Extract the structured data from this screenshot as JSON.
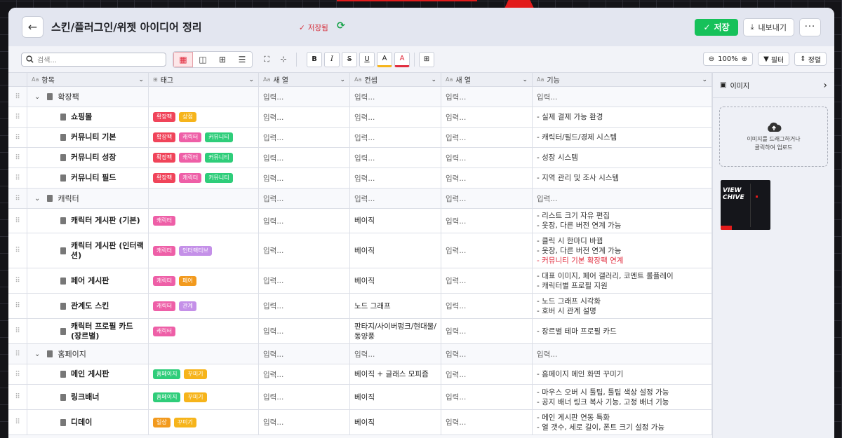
{
  "header": {
    "title": "스킨/플러그인/위젯 아이디어 정리",
    "saved": "저장됨",
    "save": "저장",
    "export": "내보내기",
    "more": "···"
  },
  "toolbar": {
    "search_placeholder": "검색...",
    "zoom": "100%",
    "filter": "필터",
    "sort": "정렬"
  },
  "columns": [
    {
      "label": "항목",
      "type": "Aa"
    },
    {
      "label": "태그",
      "type": "⊞"
    },
    {
      "label": "새 열",
      "type": "Aa"
    },
    {
      "label": "컨셉",
      "type": "Aa"
    },
    {
      "label": "새 열",
      "type": "Aa"
    },
    {
      "label": "기능",
      "type": "Aa"
    }
  ],
  "placeholder": "입력...",
  "rows": [
    {
      "kind": "group",
      "name": "확장팩",
      "tags": [],
      "concept": "",
      "func": []
    },
    {
      "kind": "item",
      "name": "쇼핑몰",
      "tags": [
        [
          "확장팩",
          "red"
        ],
        [
          "상점",
          "yel"
        ]
      ],
      "concept": "",
      "func": [
        "- 실제 결제 가능 환경"
      ]
    },
    {
      "kind": "item",
      "name": "커뮤니티 기본",
      "tags": [
        [
          "확장팩",
          "red"
        ],
        [
          "캐릭터",
          "pink"
        ],
        [
          "커뮤니티",
          "grn"
        ]
      ],
      "concept": "",
      "func": [
        "- 캐릭터/필드/경제 시스템"
      ]
    },
    {
      "kind": "item",
      "name": "커뮤니티 성장",
      "tags": [
        [
          "확장팩",
          "red"
        ],
        [
          "캐릭터",
          "pink"
        ],
        [
          "커뮤니티",
          "grn"
        ]
      ],
      "concept": "",
      "func": [
        "- 성장 시스템"
      ]
    },
    {
      "kind": "item",
      "name": "커뮤니티 필드",
      "tags": [
        [
          "확장팩",
          "red"
        ],
        [
          "캐릭터",
          "pink"
        ],
        [
          "커뮤니티",
          "grn"
        ]
      ],
      "concept": "",
      "func": [
        "- 지역 관리 및 조사 시스템"
      ]
    },
    {
      "kind": "group",
      "name": "캐릭터",
      "tags": [],
      "concept": "",
      "func": []
    },
    {
      "kind": "item",
      "name": "캐릭터 게시판 (기본)",
      "tags": [
        [
          "캐릭터",
          "pink"
        ]
      ],
      "concept": "베이직",
      "func": [
        "- 리스트 크기 자유 편집",
        "- 옷장, 다른 버전 연계 가능"
      ]
    },
    {
      "kind": "item",
      "name": "캐릭터 게시판 (인터랙션)",
      "tags": [
        [
          "캐릭터",
          "pink"
        ],
        [
          "인터랙티브",
          "lav"
        ]
      ],
      "concept": "베이직",
      "func": [
        "- 클릭 시 한마디 바뀜",
        "- 옷장, 다른 버전 연계 가능",
        "- 커뮤니티 기본 확장팩 연계"
      ]
    },
    {
      "kind": "item",
      "name": "페어 게시판",
      "tags": [
        [
          "캐릭터",
          "pink"
        ],
        [
          "페어",
          "org"
        ]
      ],
      "concept": "베이직",
      "func": [
        "- 대표 이미지, 페어 갤러리, 코멘트 롤플레이",
        "- 캐릭터별 프로필 지원"
      ]
    },
    {
      "kind": "item",
      "name": "관계도 스킨",
      "tags": [
        [
          "캐릭터",
          "pink"
        ],
        [
          "관계",
          "lav"
        ]
      ],
      "concept": "노드 그래프",
      "func": [
        "- 노드 그래프 시각화",
        "- 호버 시 관계 설명"
      ]
    },
    {
      "kind": "item",
      "name": "캐릭터 프로필 카드 (장르별)",
      "tags": [
        [
          "캐릭터",
          "pink"
        ]
      ],
      "concept": "판타지/사이버펑크/현대물/동양풍",
      "func": [
        "- 장르별 테마 프로필 카드"
      ]
    },
    {
      "kind": "group",
      "name": "홈페이지",
      "tags": [],
      "concept": "",
      "func": []
    },
    {
      "kind": "item",
      "name": "메인 게시판",
      "tags": [
        [
          "홈페이지",
          "grn"
        ],
        [
          "꾸미기",
          "yel"
        ]
      ],
      "concept": "베이직 + 글래스 모피즘",
      "func": [
        "- 홈페이지 메인 화면 꾸미기"
      ]
    },
    {
      "kind": "item",
      "name": "링크배너",
      "tags": [
        [
          "홈페이지",
          "grn"
        ],
        [
          "꾸미기",
          "yel"
        ]
      ],
      "concept": "베이직",
      "func": [
        "- 마우스 오버 시 툴팁, 툴팁 색상 설정 가능",
        "- 공지 배너 링크 복사 기능, 고정 배너 기능"
      ]
    },
    {
      "kind": "item",
      "name": "디데이",
      "tags": [
        [
          "일상",
          "org"
        ],
        [
          "꾸미기",
          "yel"
        ]
      ],
      "concept": "베이직",
      "func": [
        "- 메인 게시판 연동 특화",
        "- 열 갯수, 세로 길이, 폰트 크기 설정 가능"
      ]
    }
  ],
  "side": {
    "title": "이미지",
    "drop_text": "이미지를 드래그하거나\n클릭하여 업로드",
    "thumb_text": "VIEW\nCHIVE"
  }
}
